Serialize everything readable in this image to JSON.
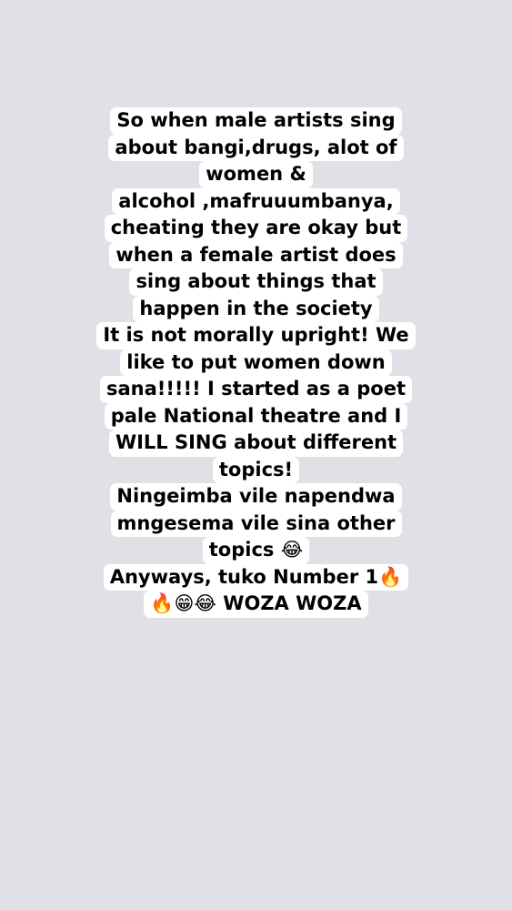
{
  "story": {
    "background_color": "#dfe1e6",
    "text_background_color": "#ffffff",
    "text_color": "#000000",
    "lines": [
      "So when male artists sing",
      "about bangi,drugs, alot of",
      "women &",
      "alcohol ,mafruuumbanya,",
      "cheating they are okay but",
      "when a female artist does",
      "sing about things that",
      "happen in the society",
      "It is not morally upright! We",
      "like to put women down",
      "sana!!!!! I started as a poet",
      "pale National theatre and I",
      "WILL SING about different",
      "topics!",
      "Ningeimba vile napendwa",
      "mngesema vile sina other",
      "topics 😂",
      "Anyways, tuko Number 1🔥",
      "🔥😁😂 WOZA WOZA"
    ]
  }
}
